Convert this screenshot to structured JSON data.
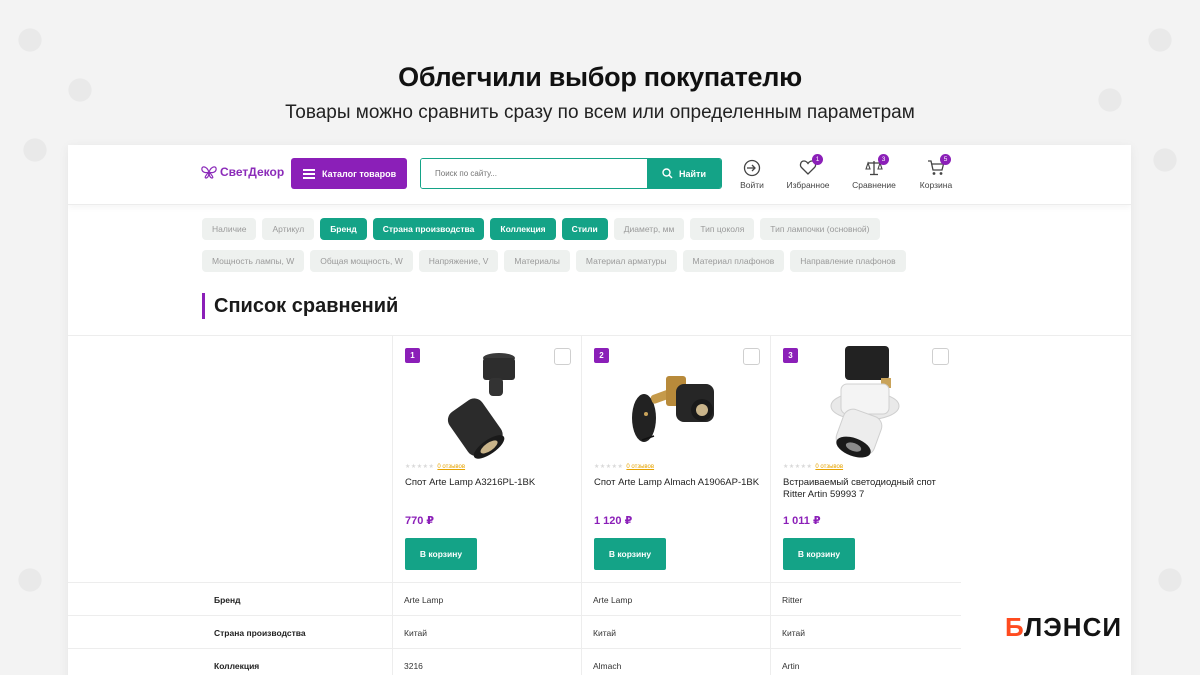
{
  "hero": {
    "title": "Облегчили выбор покупателю",
    "subtitle": "Товары можно сравнить сразу по всем или определенным параметрам"
  },
  "header": {
    "logo": "СветДекор",
    "catalog_label": "Каталог товаров",
    "search_placeholder": "Поиск по сайту...",
    "search_button": "Найти",
    "icons": [
      {
        "name": "login",
        "label": "Войти",
        "badge": ""
      },
      {
        "name": "favorites",
        "label": "Избранное",
        "badge": "1"
      },
      {
        "name": "compare",
        "label": "Сравнение",
        "badge": "3"
      },
      {
        "name": "cart",
        "label": "Корзина",
        "badge": "5"
      }
    ]
  },
  "filters": {
    "row1": [
      {
        "label": "Наличие",
        "active": false
      },
      {
        "label": "Артикул",
        "active": false
      },
      {
        "label": "Бренд",
        "active": true
      },
      {
        "label": "Страна производства",
        "active": true
      },
      {
        "label": "Коллекция",
        "active": true
      },
      {
        "label": "Стили",
        "active": true
      },
      {
        "label": "Диаметр, мм",
        "active": false
      },
      {
        "label": "Тип цоколя",
        "active": false
      },
      {
        "label": "Тип лампочки (основной)",
        "active": false
      }
    ],
    "row2": [
      {
        "label": "Мощность лампы, W",
        "active": false
      },
      {
        "label": "Общая мощность, W",
        "active": false
      },
      {
        "label": "Напряжение, V",
        "active": false
      },
      {
        "label": "Материалы",
        "active": false
      },
      {
        "label": "Материал арматуры",
        "active": false
      },
      {
        "label": "Материал плафонов",
        "active": false
      },
      {
        "label": "Направление плафонов",
        "active": false
      }
    ]
  },
  "list_title": "Список сравнений",
  "products": [
    {
      "num": "1",
      "stars": "★★★★★",
      "reviews": "0 отзывов",
      "name": "Спот Arte Lamp A3216PL-1BK",
      "price": "770 ₽",
      "cart_label": "В корзину"
    },
    {
      "num": "2",
      "stars": "★★★★★",
      "reviews": "0 отзывов",
      "name": "Спот Arte Lamp Almach A1906AP-1BK",
      "price": "1 120 ₽",
      "cart_label": "В корзину"
    },
    {
      "num": "3",
      "stars": "★★★★★",
      "reviews": "0 отзывов",
      "name": "Встраиваемый светодиодный спот Ritter Artin 59993 7",
      "price": "1 011 ₽",
      "cart_label": "В корзину"
    }
  ],
  "specs": [
    {
      "key": "Бренд",
      "values": [
        "Arte Lamp",
        "Arte Lamp",
        "Ritter"
      ]
    },
    {
      "key": "Страна производства",
      "values": [
        "Китай",
        "Китай",
        "Китай"
      ]
    },
    {
      "key": "Коллекция",
      "values": [
        "3216",
        "Almach",
        "Artin"
      ]
    }
  ],
  "brand_mark": {
    "accent": "Б",
    "rest": "ЛЭНСИ"
  },
  "colors": {
    "purple": "#8b1fb8",
    "green": "#14a387",
    "brand_orange": "#ff4b1f"
  }
}
